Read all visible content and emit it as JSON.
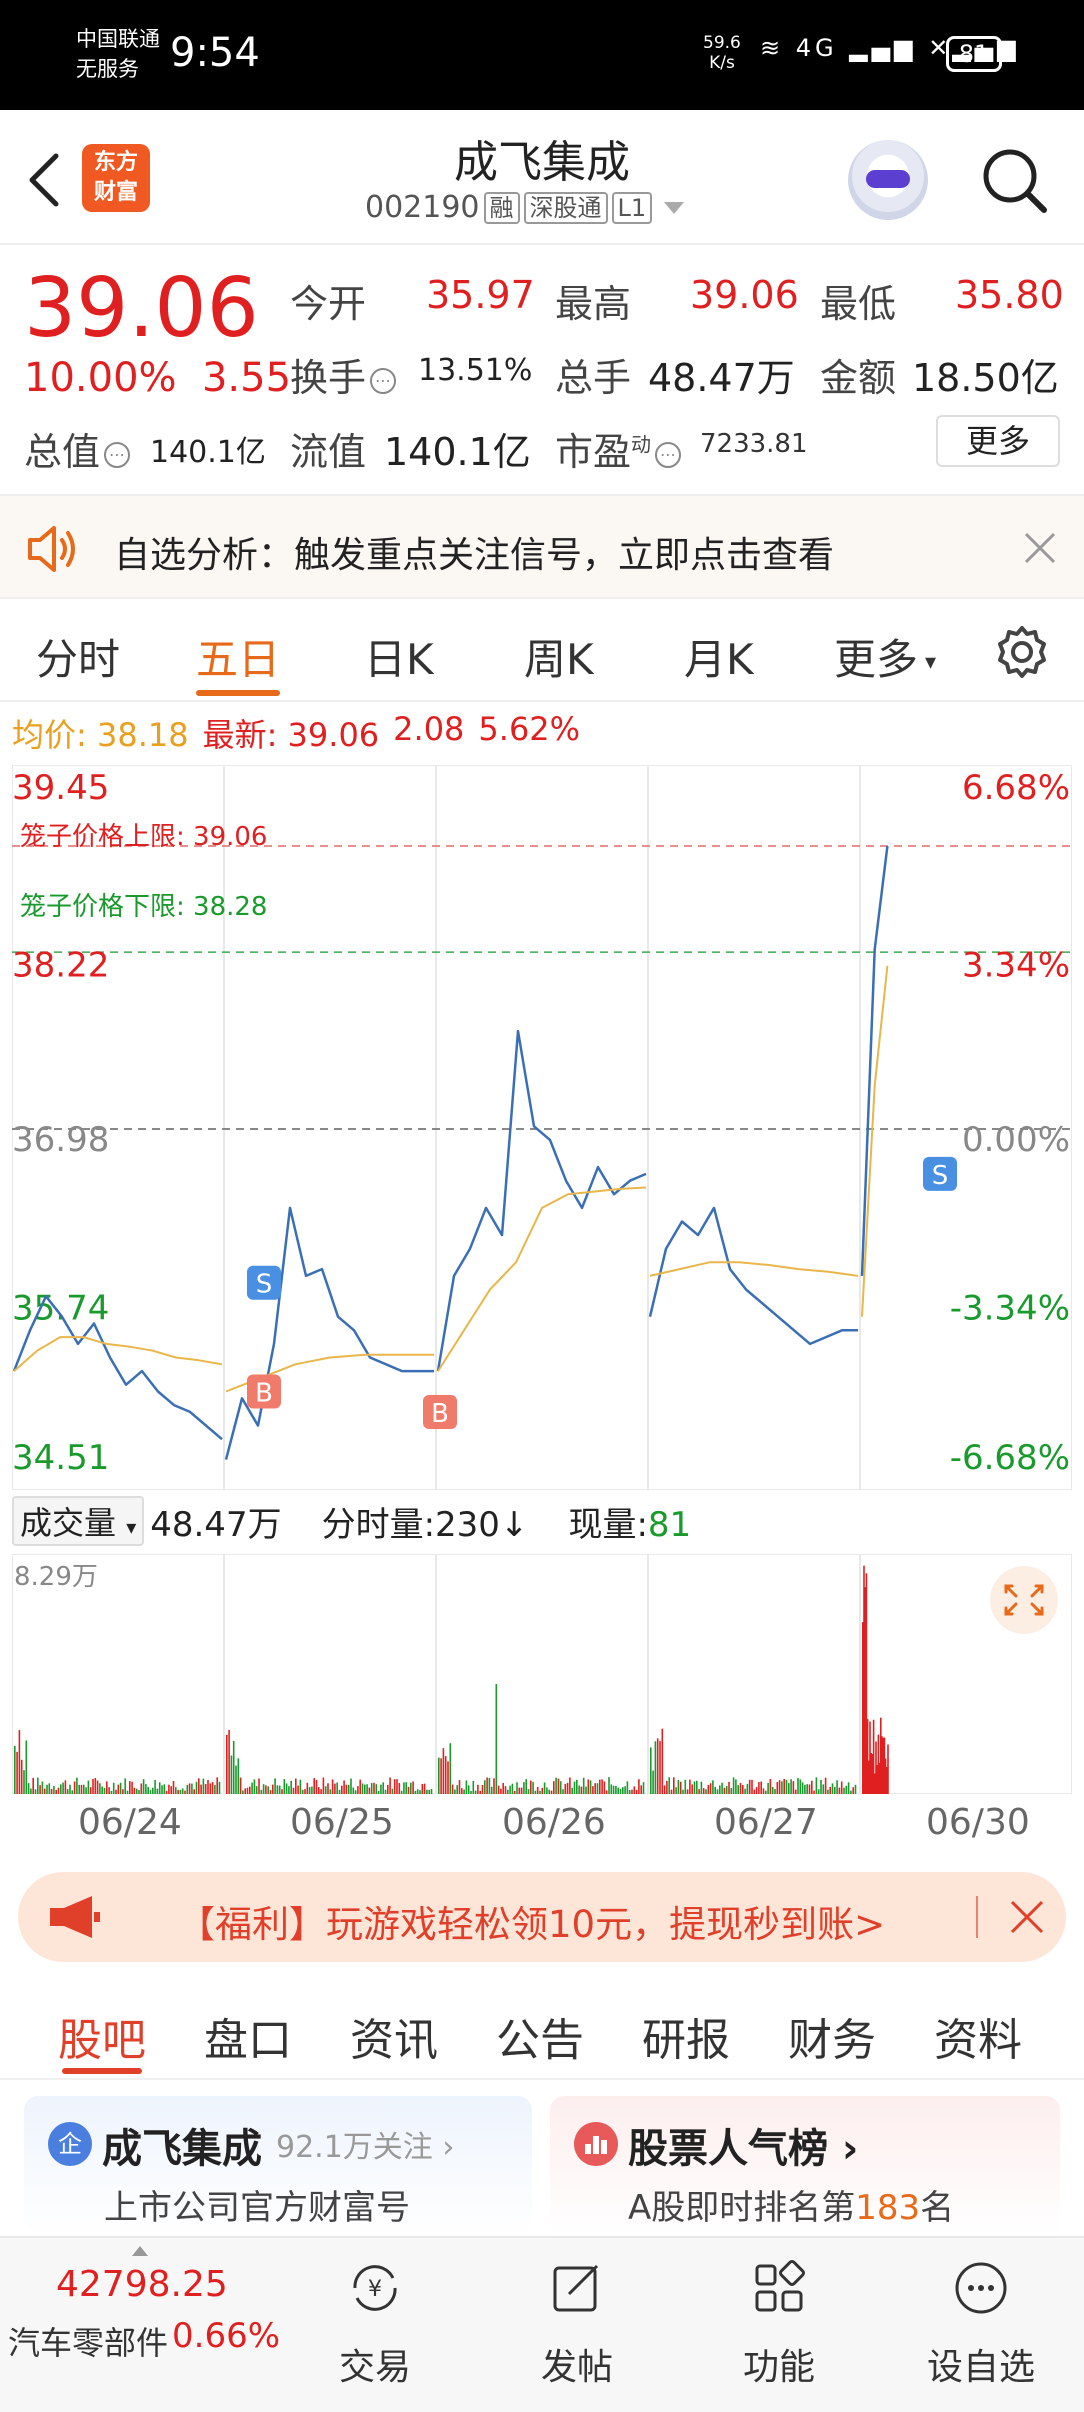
{
  "status_bar": {
    "carrier_line1": "中国联通",
    "carrier_line2": "无服务",
    "time": "9:54",
    "net_speed_value": "59.6",
    "net_speed_unit": "K/s",
    "icons": "≋ 4G ▂▄▆ ✕▂▄▆",
    "battery": "81"
  },
  "header": {
    "logo_line1": "东方",
    "logo_line2": "财富",
    "name": "成飞集成",
    "code": "002190",
    "tags": [
      "融",
      "深股通",
      "L1"
    ]
  },
  "quote": {
    "price": "39.06",
    "change_pct": "10.00%",
    "change_amt": "3.55",
    "open_label": "今开",
    "open": "35.97",
    "high_label": "最高",
    "high": "39.06",
    "low_label": "最低",
    "low": "35.80",
    "turnover_label": "换手",
    "turnover": "13.51%",
    "volume_label": "总手",
    "volume": "48.47万",
    "amount_label": "金额",
    "amount": "18.50亿",
    "mktcap_label": "总值",
    "mktcap": "140.1亿",
    "float_label": "流值",
    "float_cap": "140.1亿",
    "pe_label": "市盈",
    "pe_sup": "动",
    "pe": "7233.81",
    "more_button": "更多"
  },
  "notice": {
    "text": "自选分析：触发重点关注信号，立即点击查看"
  },
  "chart_tabs": {
    "items": [
      "分时",
      "五日",
      "日K",
      "周K",
      "月K",
      "更多"
    ],
    "active": "五日"
  },
  "avg_row": {
    "avg_label": "均价:",
    "avg_value": "38.18",
    "latest_label": "最新:",
    "latest_value": "39.06",
    "latest_change": "2.08",
    "latest_pct": "5.62%"
  },
  "chart_data": {
    "type": "line",
    "title": "",
    "y_left_ticks": [
      "39.45",
      "38.22",
      "36.98",
      "35.74",
      "34.51"
    ],
    "y_right_ticks": [
      "6.68%",
      "3.34%",
      "0.00%",
      "-3.34%",
      "-6.68%"
    ],
    "ylim": [
      34.51,
      39.45
    ],
    "x_labels": [
      "06/24",
      "06/25",
      "06/26",
      "06/27",
      "06/30"
    ],
    "cage_upper_label": "笼子价格上限:",
    "cage_upper_value": "39.06",
    "cage_lower_label": "笼子价格下限:",
    "cage_lower_value": "38.28",
    "markers": [
      {
        "label": "S",
        "day": 1,
        "value": 35.85
      },
      {
        "label": "B",
        "day": 1,
        "value": 35.05
      },
      {
        "label": "B",
        "day": 2,
        "value": 34.9
      },
      {
        "label": "S",
        "day": 4,
        "value": 36.65
      }
    ],
    "series": [
      {
        "name": "价格",
        "color": "#3a6fb5",
        "days": [
          [
            35.2,
            35.5,
            35.75,
            35.6,
            35.4,
            35.55,
            35.3,
            35.1,
            35.2,
            35.05,
            34.95,
            34.9,
            34.8,
            34.7
          ],
          [
            34.55,
            35.0,
            34.8,
            35.4,
            36.4,
            35.9,
            35.95,
            35.6,
            35.5,
            35.3,
            35.25,
            35.2,
            35.2,
            35.2
          ],
          [
            35.2,
            35.9,
            36.1,
            36.4,
            36.2,
            37.7,
            37.0,
            36.9,
            36.6,
            36.4,
            36.7,
            36.5,
            36.6,
            36.65
          ],
          [
            35.6,
            36.1,
            36.3,
            36.2,
            36.4,
            35.95,
            35.8,
            35.7,
            35.6,
            35.5,
            35.4,
            35.45,
            35.5,
            35.5
          ],
          [
            35.9,
            38.3,
            39.06
          ]
        ]
      },
      {
        "name": "均价",
        "color": "#e8b64a",
        "days": [
          [
            35.2,
            35.35,
            35.45,
            35.45,
            35.4,
            35.38,
            35.35,
            35.3,
            35.28,
            35.25
          ],
          [
            35.05,
            35.15,
            35.25,
            35.3,
            35.32,
            35.32,
            35.32
          ],
          [
            35.2,
            35.5,
            35.8,
            36.0,
            36.4,
            36.5,
            36.52,
            36.54,
            36.55
          ],
          [
            35.9,
            35.95,
            36.0,
            36.0,
            35.98,
            35.95,
            35.93,
            35.9
          ],
          [
            35.6,
            37.3,
            38.18
          ]
        ]
      }
    ]
  },
  "volume": {
    "label": "成交量",
    "total": "48.47万",
    "tick_label": "分时量:",
    "tick_value": "230",
    "tick_arrow": "↓",
    "now_label": "现量:",
    "now_value": "81",
    "max_label": "8.29万"
  },
  "ad": {
    "text": "【福利】玩游戏轻松领10元，提现秒到账>"
  },
  "section_tabs": {
    "items": [
      "股吧",
      "盘口",
      "资讯",
      "公告",
      "研报",
      "财务",
      "资料"
    ],
    "active": "股吧"
  },
  "cards": {
    "official": {
      "icon_text": "企",
      "title": "成飞集成",
      "followers": "92.1万关注 ›",
      "desc": "上市公司官方财富号"
    },
    "ranking": {
      "title": "股票人气榜 ›",
      "desc_prefix": "A股即时排名第",
      "rank": "183",
      "desc_suffix": "名"
    }
  },
  "bottom_nav": {
    "index_value": "42798.25",
    "index_name": "汽车零部件",
    "index_pct": "0.66%",
    "items": [
      "交易",
      "发帖",
      "功能",
      "设自选"
    ]
  }
}
